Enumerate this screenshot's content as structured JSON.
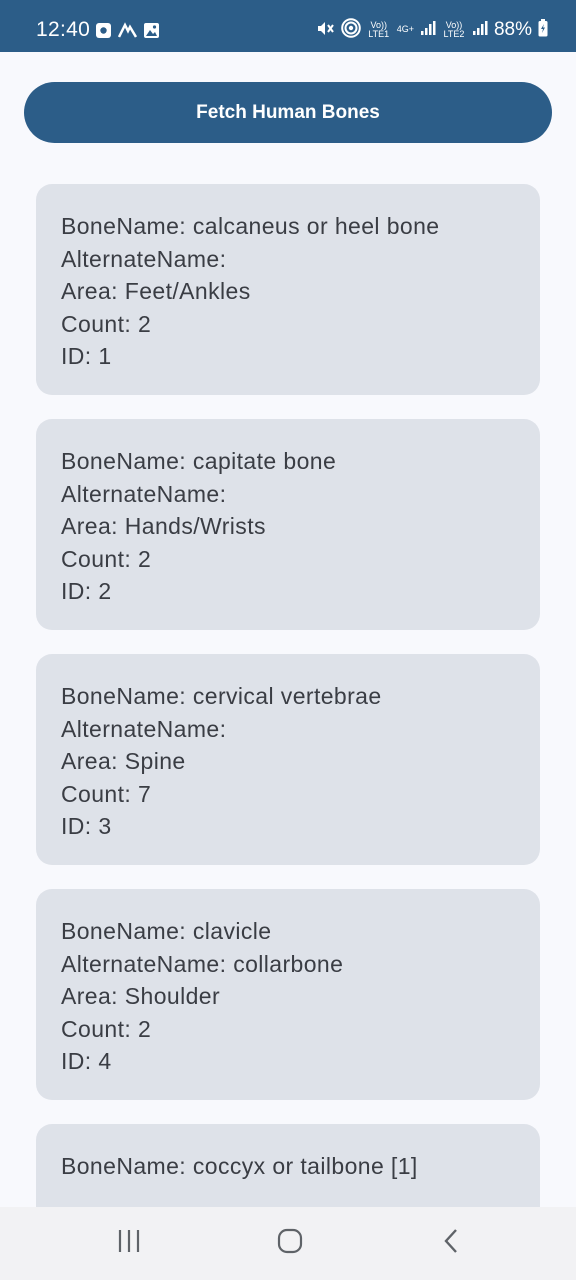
{
  "status_bar": {
    "time": "12:40",
    "network_label_1": "Vo)) LTE1",
    "network_label_2": "4G+",
    "network_label_3": "Vo)) LTE2",
    "battery": "88%",
    "icons": [
      "notification-icon",
      "activity-icon",
      "gallery-icon",
      "mute-icon",
      "hotspot-icon",
      "signal-icon",
      "battery-icon"
    ]
  },
  "main": {
    "fetch_button_label": "Fetch Human Bones",
    "cards": [
      {
        "bone_name": "BoneName: calcaneus or heel bone",
        "alternate_name": "AlternateName:",
        "area": "Area: Feet/Ankles",
        "count": "Count: 2",
        "id": "ID: 1"
      },
      {
        "bone_name": "BoneName: capitate bone",
        "alternate_name": "AlternateName:",
        "area": "Area: Hands/Wrists",
        "count": "Count: 2",
        "id": "ID: 2"
      },
      {
        "bone_name": "BoneName: cervical vertebrae",
        "alternate_name": "AlternateName:",
        "area": "Area: Spine",
        "count": "Count: 7",
        "id": "ID: 3"
      },
      {
        "bone_name": "BoneName: clavicle",
        "alternate_name": "AlternateName: collarbone",
        "area": "Area: Shoulder",
        "count": "Count: 2",
        "id": "ID: 4"
      },
      {
        "bone_name": "BoneName: coccyx or tailbone [1]",
        "alternate_name": "",
        "area": "",
        "count": "",
        "id": ""
      }
    ]
  },
  "nav_bar": {
    "icons": [
      "recent-apps-icon",
      "home-icon",
      "back-icon"
    ]
  },
  "colors": {
    "primary": "#2c5d88",
    "background": "#f8f9fd",
    "card": "#dee2e9",
    "card_text": "#3a3d44"
  }
}
